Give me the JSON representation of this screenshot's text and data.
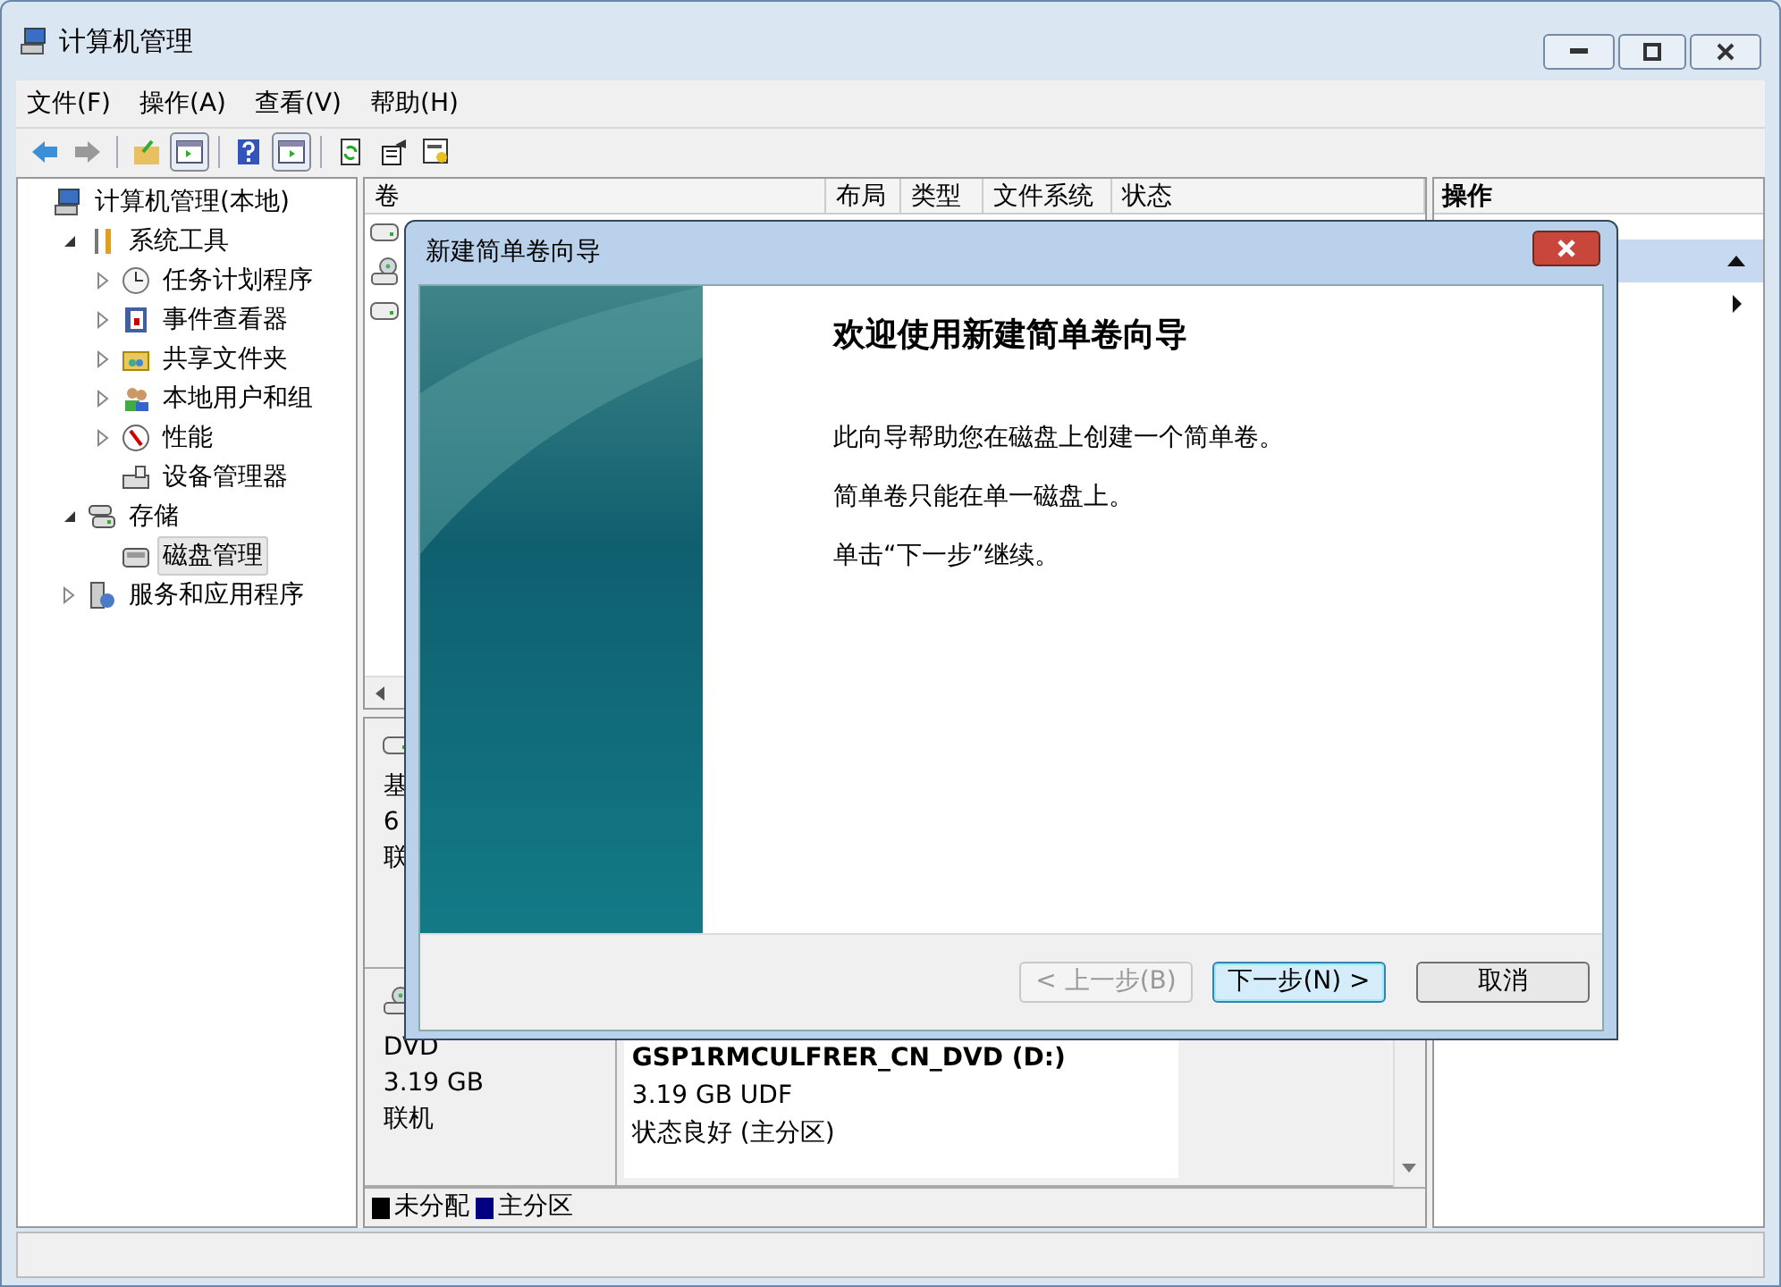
{
  "window": {
    "title": "计算机管理"
  },
  "menu": [
    "文件(F)",
    "操作(A)",
    "查看(V)",
    "帮助(H)"
  ],
  "toolbar": [
    {
      "kind": "back",
      "disabled": false
    },
    {
      "kind": "forward",
      "disabled": true
    },
    {
      "kind": "sep"
    },
    {
      "kind": "up"
    },
    {
      "kind": "tree"
    },
    {
      "kind": "sep"
    },
    {
      "kind": "help"
    },
    {
      "kind": "pane"
    },
    {
      "kind": "sep"
    },
    {
      "kind": "refresh"
    },
    {
      "kind": "props"
    },
    {
      "kind": "wizard"
    }
  ],
  "tree": [
    {
      "label": "计算机管理(本地)",
      "kind": "computer",
      "selected": false,
      "children": [
        {
          "label": "系统工具",
          "kind": "tools",
          "expanded": true,
          "selected": false,
          "children": [
            {
              "label": "任务计划程序",
              "kind": "clock",
              "expanded": false,
              "selected": false
            },
            {
              "label": "事件查看器",
              "kind": "event",
              "expanded": false,
              "selected": false
            },
            {
              "label": "共享文件夹",
              "kind": "share",
              "expanded": false,
              "selected": false
            },
            {
              "label": "本地用户和组",
              "kind": "users",
              "expanded": false,
              "selected": false
            },
            {
              "label": "性能",
              "kind": "perf",
              "expanded": false,
              "selected": false
            },
            {
              "label": "设备管理器",
              "kind": "device",
              "selected": false
            }
          ]
        },
        {
          "label": "存储",
          "kind": "storage",
          "expanded": true,
          "selected": false,
          "children": [
            {
              "label": "磁盘管理",
              "kind": "disk",
              "selected": true
            }
          ]
        },
        {
          "label": "服务和应用程序",
          "kind": "services",
          "expanded": false,
          "selected": false
        }
      ]
    }
  ],
  "volumes": {
    "columns": [
      "卷",
      "布局",
      "类型",
      "文件系统",
      "状态"
    ],
    "rows": [
      {
        "kind": "disk"
      },
      {
        "kind": "dvd"
      },
      {
        "kind": "disk"
      }
    ]
  },
  "disks": [
    {
      "kind": "disk",
      "lines": [
        "基",
        "6",
        "联"
      ]
    },
    {
      "kind": "dvd",
      "lines": [
        "DVD",
        "3.19 GB",
        "联机"
      ],
      "partition": {
        "title": "GSP1RMCULFRER_CN_DVD (D:)",
        "lines": [
          "3.19 GB UDF",
          "状态良好 (主分区)"
        ]
      }
    }
  ],
  "legend": [
    {
      "label": "未分配",
      "color": "#000000"
    },
    {
      "label": "主分区",
      "color": "#000080"
    }
  ],
  "actions": {
    "header": "操作"
  },
  "dialog": {
    "title": "新建简单卷向导",
    "heading": "欢迎使用新建简单卷向导",
    "paragraphs": [
      "此向导帮助您在磁盘上创建一个简单卷。",
      "简单卷只能在单一磁盘上。",
      "单击“下一步”继续。"
    ],
    "buttons": [
      {
        "label": "< 上一步(B)",
        "disabled": true,
        "default": false
      },
      {
        "label": "下一步(N) >",
        "disabled": false,
        "default": true
      },
      {
        "label": "取消",
        "disabled": false,
        "default": false
      }
    ]
  }
}
